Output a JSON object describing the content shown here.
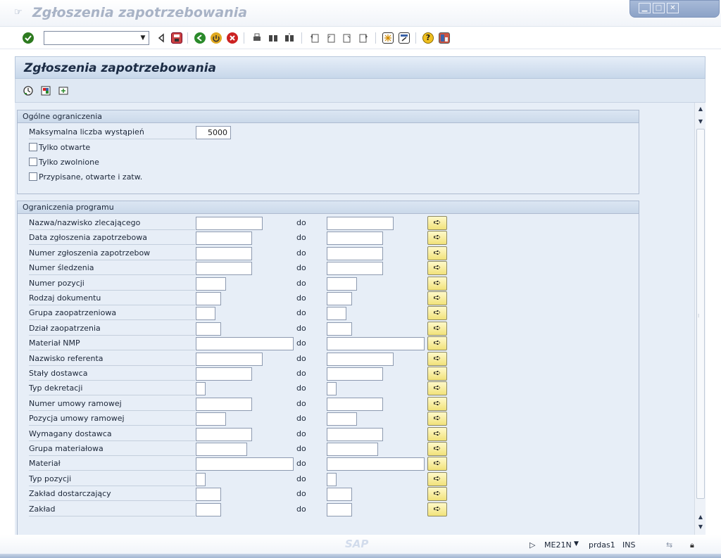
{
  "window": {
    "title": "Zgłoszenia zapotrzebowania",
    "controls": [
      "minimize",
      "maximize",
      "close"
    ]
  },
  "toolbar": {
    "command_value": "",
    "icons": [
      "enter-icon",
      "back-icon",
      "save-icon",
      "green-back-icon",
      "exit-icon",
      "cancel-icon",
      "print-icon",
      "find-icon",
      "find-next-icon",
      "first-page-icon",
      "previous-page-icon",
      "next-page-icon",
      "last-page-icon",
      "new-session-icon",
      "shortcut-icon",
      "help-icon",
      "customize-layout-icon"
    ]
  },
  "screen": {
    "header_title": "Zgłoszenia zapotrzebowania",
    "app_toolbar_icons": [
      "execute-icon",
      "selection-options-icon",
      "dynamic-selections-icon"
    ]
  },
  "group1": {
    "title": "Ogólne ograniczenia",
    "max_label": "Maksymalna liczba wystąpień",
    "max_value": "5000",
    "checkboxes": [
      {
        "label": "Tylko otwarte",
        "checked": false
      },
      {
        "label": "Tylko zwolnione",
        "checked": false
      },
      {
        "label": "Przypisane, otwarte i zatw.",
        "checked": false
      }
    ]
  },
  "group2": {
    "title": "Ograniczenia programu",
    "to_label": "do",
    "rows": [
      {
        "label": "Nazwa/nazwisko zlecającego",
        "from": "",
        "to": ""
      },
      {
        "label": "Data zgłoszenia zapotrzebowa",
        "from": "",
        "to": ""
      },
      {
        "label": "Numer zgłoszenia zapotrzebow",
        "from": "",
        "to": ""
      },
      {
        "label": "Numer śledzenia",
        "from": "",
        "to": ""
      },
      {
        "label": "Numer pozycji",
        "from": "",
        "to": ""
      },
      {
        "label": "Rodzaj dokumentu",
        "from": "",
        "to": ""
      },
      {
        "label": "Grupa zaopatrzeniowa",
        "from": "",
        "to": ""
      },
      {
        "label": "Dział zaopatrzenia",
        "from": "",
        "to": ""
      },
      {
        "label": "Materiał NMP",
        "from": "",
        "to": ""
      },
      {
        "label": "Nazwisko referenta",
        "from": "",
        "to": ""
      },
      {
        "label": "Stały dostawca",
        "from": "",
        "to": ""
      },
      {
        "label": "Typ dekretacji",
        "from": "",
        "to": ""
      },
      {
        "label": "Numer umowy ramowej",
        "from": "",
        "to": ""
      },
      {
        "label": "Pozycja umowy ramowej",
        "from": "",
        "to": ""
      },
      {
        "label": "Wymagany dostawca",
        "from": "",
        "to": ""
      },
      {
        "label": "Grupa materiałowa",
        "from": "",
        "to": ""
      },
      {
        "label": "Materiał",
        "from": "",
        "to": ""
      },
      {
        "label": "Typ pozycji",
        "from": "",
        "to": ""
      },
      {
        "label": "Zakład dostarczający",
        "from": "",
        "to": ""
      },
      {
        "label": "Zakład",
        "from": "",
        "to": ""
      }
    ]
  },
  "status": {
    "logo": "SAP",
    "transaction": "ME21N",
    "server": "prdas1",
    "mode": "INS"
  },
  "colors": {
    "header_bg": "#c7d7ea",
    "content_bg": "#e7eef7",
    "multisel_btn": "#f1e27a"
  }
}
